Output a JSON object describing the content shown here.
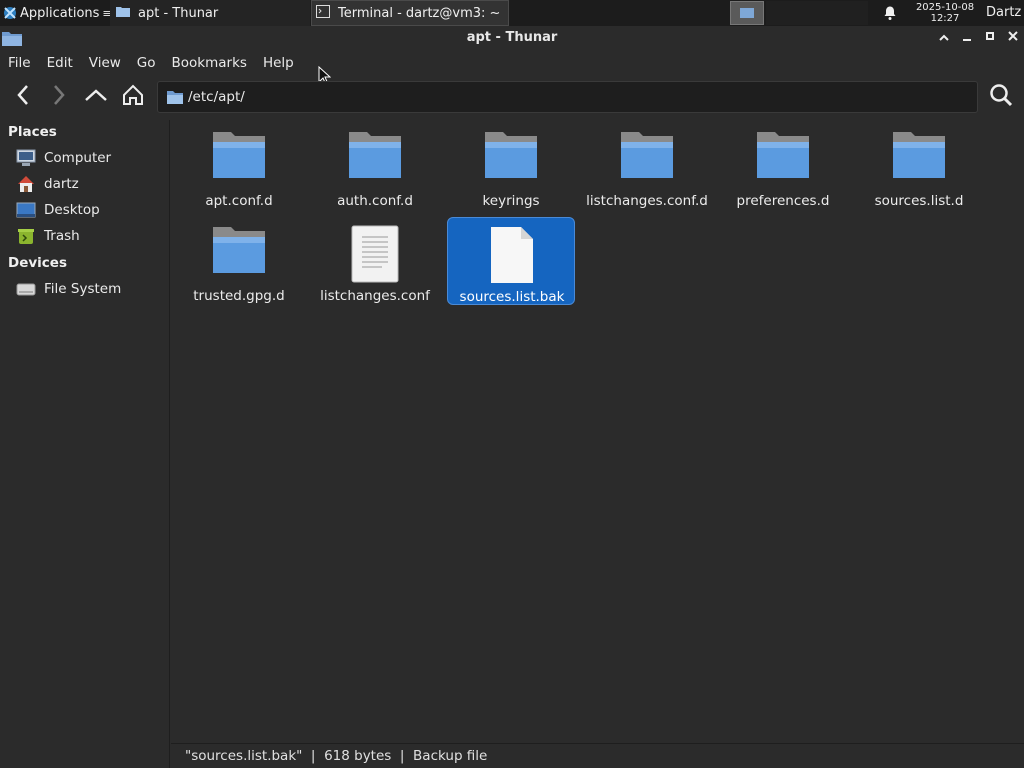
{
  "panel": {
    "apps_label": "Applications",
    "tasks": [
      {
        "label": "apt - Thunar"
      },
      {
        "label": "Terminal - dartz@vm3: ~"
      }
    ],
    "clock_date": "2025-10-08",
    "clock_time": "12:27",
    "user": "Dartz"
  },
  "window": {
    "title": "apt - Thunar"
  },
  "menu": {
    "items": [
      "File",
      "Edit",
      "View",
      "Go",
      "Bookmarks",
      "Help"
    ]
  },
  "location": {
    "path": "/etc/apt/"
  },
  "sidebar": {
    "places_heading": "Places",
    "places": [
      {
        "label": "Computer",
        "icon": "computer-icon"
      },
      {
        "label": "dartz",
        "icon": "home-icon"
      },
      {
        "label": "Desktop",
        "icon": "desktop-icon"
      },
      {
        "label": "Trash",
        "icon": "trash-icon"
      }
    ],
    "devices_heading": "Devices",
    "devices": [
      {
        "label": "File System",
        "icon": "drive-icon"
      }
    ]
  },
  "files": [
    {
      "name": "apt.conf.d",
      "type": "folder"
    },
    {
      "name": "auth.conf.d",
      "type": "folder"
    },
    {
      "name": "keyrings",
      "type": "folder"
    },
    {
      "name": "listchanges.conf.d",
      "type": "folder"
    },
    {
      "name": "preferences.d",
      "type": "folder"
    },
    {
      "name": "sources.list.d",
      "type": "folder"
    },
    {
      "name": "trusted.gpg.d",
      "type": "folder"
    },
    {
      "name": "listchanges.conf",
      "type": "text-file"
    },
    {
      "name": "sources.list.bak",
      "type": "file",
      "selected": true
    }
  ],
  "status": {
    "text": "\"sources.list.bak\"  |  618 bytes  |  Backup file"
  },
  "colors": {
    "selection": "#1565c0",
    "folder": "#5b9be0",
    "background": "#2b2b2b"
  }
}
